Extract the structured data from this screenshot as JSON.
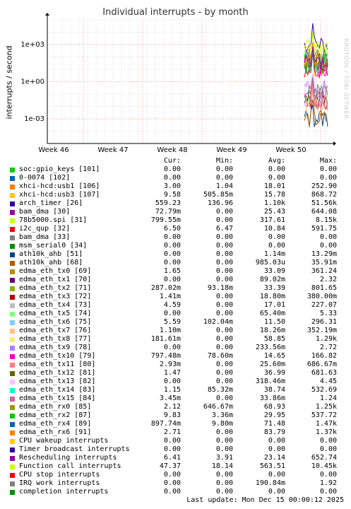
{
  "title": "Individual interrupts - by month",
  "ylabel": "interrupts / second",
  "watermark": "RRDTOOL / TOBI OETIKER",
  "headers": {
    "cur": "Cur:",
    "min": "Min:",
    "avg": "Avg:",
    "max": "Max:"
  },
  "last_update": "Last update: Mon Dec 15 00:00:12 2025",
  "colors": {
    "grid_major": "#ff9999",
    "grid_minor": "#dddddd",
    "axis": "#000000",
    "background": "#ffffff"
  },
  "chart_data": {
    "type": "line",
    "title": "Individual interrupts - by month",
    "ylabel": "interrupts / second",
    "xlabel": "",
    "y_scale": "log",
    "y_ticks": [
      "1e+03",
      "1e+00",
      "1e-03"
    ],
    "ylim": [
      1e-05,
      100000
    ],
    "x_ticks": [
      "Week 46",
      "Week 47",
      "Week 48",
      "Week 49",
      "Week 50"
    ],
    "grid": true,
    "legend_placement": "below",
    "data_present_from": "late Week 50"
  },
  "legend": [
    {
      "color": "#00cc00",
      "name": "soc:gpio_keys [101]",
      "cur": "0.00",
      "min": "0.00",
      "avg": "0.00",
      "max": "0.00"
    },
    {
      "color": "#0066b3",
      "name": "0-0074 [102]",
      "cur": "0.00",
      "min": "0.00",
      "avg": "0.00",
      "max": "0.00"
    },
    {
      "color": "#ff8000",
      "name": "xhci-hcd:usb1 [106]",
      "cur": "3.00",
      "min": "1.04",
      "avg": "18.01",
      "max": "252.90"
    },
    {
      "color": "#ffcc00",
      "name": "xhci-hcd:usb3 [107]",
      "cur": "9.58",
      "min": "505.85m",
      "avg": "15.78",
      "max": "868.72"
    },
    {
      "color": "#330099",
      "name": "arch_timer [26]",
      "cur": "559.23",
      "min": "136.96",
      "avg": "1.10k",
      "max": "51.56k"
    },
    {
      "color": "#990099",
      "name": "bam_dma [30]",
      "cur": "72.79m",
      "min": "0.00",
      "avg": "25.43",
      "max": "644.08"
    },
    {
      "color": "#ccff00",
      "name": "78b5000.spi [31]",
      "cur": "799.55m",
      "min": "0.00",
      "avg": "317.61",
      "max": "8.15k"
    },
    {
      "color": "#ff0000",
      "name": "i2c_qup [32]",
      "cur": "6.50",
      "min": "6.47",
      "avg": "10.84",
      "max": "591.75"
    },
    {
      "color": "#808080",
      "name": "bam_dma [33]",
      "cur": "0.00",
      "min": "0.00",
      "avg": "0.00",
      "max": "0.00"
    },
    {
      "color": "#008f00",
      "name": "msm_serial0 [34]",
      "cur": "0.00",
      "min": "0.00",
      "avg": "0.00",
      "max": "0.00"
    },
    {
      "color": "#00487d",
      "name": "ath10k_ahb [51]",
      "cur": "0.00",
      "min": "0.00",
      "avg": "1.14m",
      "max": "13.29m"
    },
    {
      "color": "#b35a00",
      "name": "ath10k_ahb [68]",
      "cur": "0.00",
      "min": "0.00",
      "avg": "985.03u",
      "max": "35.91m"
    },
    {
      "color": "#b38f00",
      "name": "edma_eth_tx0 [69]",
      "cur": "1.65",
      "min": "0.00",
      "avg": "33.09",
      "max": "361.24"
    },
    {
      "color": "#6b006b",
      "name": "edma_eth_tx1 [70]",
      "cur": "0.00",
      "min": "0.00",
      "avg": "89.02m",
      "max": "2.32"
    },
    {
      "color": "#8fb300",
      "name": "edma_eth_tx2 [71]",
      "cur": "287.02m",
      "min": "93.18m",
      "avg": "33.39",
      "max": "801.65"
    },
    {
      "color": "#b30000",
      "name": "edma_eth_tx3 [72]",
      "cur": "1.41m",
      "min": "0.00",
      "avg": "18.80m",
      "max": "380.00m"
    },
    {
      "color": "#bebebe",
      "name": "edma_eth_tx4 [73]",
      "cur": "4.59",
      "min": "0.00",
      "avg": "17.01",
      "max": "227.07"
    },
    {
      "color": "#80ff80",
      "name": "edma_eth_tx5 [74]",
      "cur": "0.00",
      "min": "0.00",
      "avg": "65.40m",
      "max": "5.33"
    },
    {
      "color": "#80c9ff",
      "name": "edma_eth_tx6 [75]",
      "cur": "5.59",
      "min": "102.04m",
      "avg": "11.50",
      "max": "296.31"
    },
    {
      "color": "#ffc080",
      "name": "edma_eth_tx7 [76]",
      "cur": "1.10m",
      "min": "0.00",
      "avg": "18.26m",
      "max": "352.19m"
    },
    {
      "color": "#ffe680",
      "name": "edma_eth_tx8 [77]",
      "cur": "181.61m",
      "min": "0.00",
      "avg": "58.85",
      "max": "1.29k"
    },
    {
      "color": "#aa80ff",
      "name": "edma_eth_tx9 [78]",
      "cur": "0.00",
      "min": "0.00",
      "avg": "233.56m",
      "max": "2.72"
    },
    {
      "color": "#ee00cc",
      "name": "edma_eth_tx10 [79]",
      "cur": "797.48m",
      "min": "78.60m",
      "avg": "14.65",
      "max": "166.82"
    },
    {
      "color": "#ff8080",
      "name": "edma_eth_tx11 [80]",
      "cur": "2.93m",
      "min": "0.00",
      "avg": "25.60m",
      "max": "686.67m"
    },
    {
      "color": "#666600",
      "name": "edma_eth_tx12 [81]",
      "cur": "1.47",
      "min": "0.00",
      "avg": "36.99",
      "max": "681.63"
    },
    {
      "color": "#ffbfff",
      "name": "edma_eth_tx13 [82]",
      "cur": "0.00",
      "min": "0.00",
      "avg": "318.46m",
      "max": "4.45"
    },
    {
      "color": "#00ffcc",
      "name": "edma_eth_tx14 [83]",
      "cur": "1.15",
      "min": "85.32m",
      "avg": "38.74",
      "max": "532.69"
    },
    {
      "color": "#cc6699",
      "name": "edma_eth_tx15 [84]",
      "cur": "3.45m",
      "min": "0.00",
      "avg": "33.86m",
      "max": "1.24"
    },
    {
      "color": "#999900",
      "name": "edma_eth_rx0 [85]",
      "cur": "2.12",
      "min": "646.67m",
      "avg": "68.93",
      "max": "1.25k"
    },
    {
      "color": "#00cc00",
      "name": "edma_eth_rx2 [87]",
      "cur": "9.83",
      "min": "3.36m",
      "avg": "29.95",
      "max": "537.72"
    },
    {
      "color": "#0066b3",
      "name": "edma_eth_rx4 [89]",
      "cur": "897.74m",
      "min": "9.80m",
      "avg": "71.48",
      "max": "1.47k"
    },
    {
      "color": "#ff8000",
      "name": "edma_eth_rx6 [91]",
      "cur": "2.71",
      "min": "0.00",
      "avg": "83.79",
      "max": "1.37k"
    },
    {
      "color": "#ffcc00",
      "name": "CPU wakeup interrupts",
      "cur": "0.00",
      "min": "0.00",
      "avg": "0.00",
      "max": "0.00"
    },
    {
      "color": "#330099",
      "name": "Timer broadcast interrupts",
      "cur": "0.00",
      "min": "0.00",
      "avg": "0.00",
      "max": "0.00"
    },
    {
      "color": "#990099",
      "name": "Rescheduling interrupts",
      "cur": "6.41",
      "min": "3.91",
      "avg": "23.14",
      "max": "652.74"
    },
    {
      "color": "#ccff00",
      "name": "Function call interrupts",
      "cur": "47.37",
      "min": "18.14",
      "avg": "563.51",
      "max": "10.45k"
    },
    {
      "color": "#ff0000",
      "name": "CPU stop interrupts",
      "cur": "0.00",
      "min": "0.00",
      "avg": "0.00",
      "max": "0.00"
    },
    {
      "color": "#808080",
      "name": "IRQ work interrupts",
      "cur": "0.00",
      "min": "0.00",
      "avg": "190.84m",
      "max": "1.92"
    },
    {
      "color": "#008f00",
      "name": "completion interrupts",
      "cur": "0.00",
      "min": "0.00",
      "avg": "0.00",
      "max": "0.00"
    }
  ]
}
